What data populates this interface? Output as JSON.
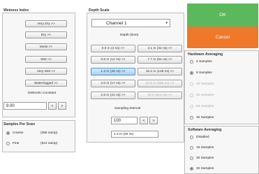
{
  "wetness_group": {
    "title": "Wetness Index",
    "buttons": [
      "Very Dry >>",
      "Dry >>",
      "Moist >>",
      "Wet >>",
      "Very Wet >>",
      "Waterlogged >>"
    ],
    "dielectric_label": "Dielectric Constant",
    "dielectric_value": "9.00",
    "dec_label": "<",
    "inc_label": ">"
  },
  "samples_group": {
    "title": "Samples Per Scan",
    "options": [
      {
        "label": "Coarse",
        "value": "(256 samp)",
        "checked": true
      },
      {
        "label": "Fine",
        "value": "(512 samp)",
        "checked": false
      }
    ]
  },
  "depth_group": {
    "title": "Depth Scale",
    "channel_value": "Channel 1",
    "dropdown_arrow": "▾",
    "depth_label": "Depth (time)",
    "buttons": [
      {
        "label": "0.5 m (4 ns) >>",
        "state": "normal"
      },
      {
        "label": "4.1 m (32 ns) >>",
        "state": "normal"
      },
      {
        "label": "0.6 m (12 ns) >>",
        "state": "normal"
      },
      {
        "label": "7.7 m (64 ns) >>",
        "state": "normal"
      },
      {
        "label": "1.3 m (26 ns) >>",
        "state": "selected"
      },
      {
        "label": "16.2 m (128 ns) >>",
        "state": "normal"
      },
      {
        "label": "2.0 m (17 ns) >>",
        "state": "normal"
      },
      {
        "label": "20.5 m (256 ns) >>",
        "state": "disabled"
      },
      {
        "label": "2.6 m (21 ns) >>",
        "state": "normal"
      },
      {
        "label": "32.0 (512 ns) >>",
        "state": "disabled"
      }
    ],
    "sampling_label": "Sampling Interval",
    "sampling_value": "100",
    "dec_label": "<",
    "inc_label": ">",
    "depth_readout": "1.3 m (26 ns)"
  },
  "actions": {
    "ok_label": "OK",
    "cancel_label": "Cancel",
    "ok_color": "#5cb85c",
    "cancel_color": "#f0782a"
  },
  "hardware_group": {
    "title": "Hardware Averaging",
    "options": [
      {
        "label": "4 Samples",
        "checked": false,
        "disabled": false
      },
      {
        "label": "8 Samples",
        "checked": true,
        "disabled": false
      },
      {
        "label": "16 Samples",
        "checked": false,
        "disabled": true
      },
      {
        "label": "32 Samples",
        "checked": false,
        "disabled": true
      },
      {
        "label": "64 Samples",
        "checked": false,
        "disabled": true
      },
      {
        "label": "32 Samples",
        "checked": false,
        "disabled": false
      }
    ]
  },
  "software_group": {
    "title": "Software Averaging",
    "options": [
      {
        "label": "Disabled",
        "checked": false,
        "disabled": false
      },
      {
        "label": "16 Samples",
        "checked": false,
        "disabled": false
      },
      {
        "label": "20 Samples",
        "checked": false,
        "disabled": false
      },
      {
        "label": "32 Samples",
        "checked": true,
        "disabled": false
      }
    ]
  }
}
